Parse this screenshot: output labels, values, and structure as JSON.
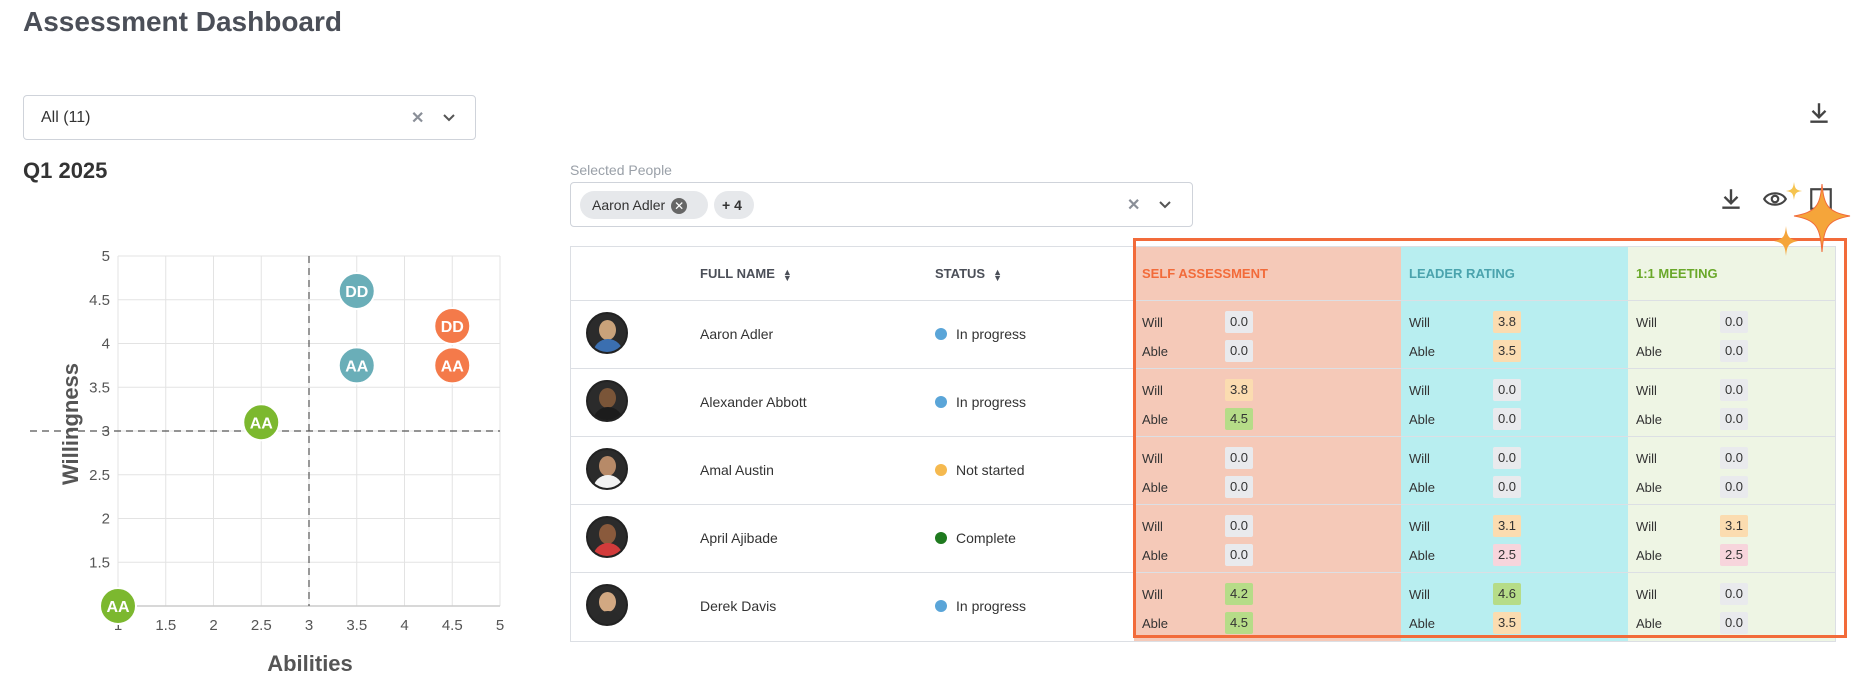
{
  "page": {
    "title": "Assessment Dashboard"
  },
  "filter": {
    "value": "All (11)"
  },
  "period": "Q1 2025",
  "chart_data": {
    "type": "scatter",
    "xlabel": "Abilities",
    "ylabel": "Willingness",
    "xlim": [
      1,
      5
    ],
    "ylim": [
      1,
      5
    ],
    "x_ticks": [
      "1",
      "1.5",
      "2",
      "2.5",
      "3",
      "3.5",
      "4",
      "4.5",
      "5"
    ],
    "y_ticks": [
      "1.5",
      "2",
      "2.5",
      "3",
      "3.5",
      "4",
      "4.5",
      "5"
    ],
    "grid": true,
    "reference_lines": {
      "x": 3,
      "y": 3
    },
    "points": [
      {
        "label": "DD",
        "x": 3.5,
        "y": 4.6,
        "color": "#6aaeb8"
      },
      {
        "label": "DD",
        "x": 4.5,
        "y": 4.2,
        "color": "#f47a4a"
      },
      {
        "label": "AA",
        "x": 3.5,
        "y": 3.75,
        "color": "#6aaeb8"
      },
      {
        "label": "AA",
        "x": 4.5,
        "y": 3.75,
        "color": "#f47a4a"
      },
      {
        "label": "AA",
        "x": 2.5,
        "y": 3.1,
        "color": "#7cb82f"
      },
      {
        "label": "AA",
        "x": 1,
        "y": 1,
        "color": "#7cb82f"
      }
    ]
  },
  "selected_people": {
    "label": "Selected People",
    "chip": "Aaron Adler",
    "more": "+ 4"
  },
  "table": {
    "headers": {
      "full_name": "FULL NAME",
      "status": "STATUS",
      "self": "SELF ASSESSMENT",
      "leader": "LEADER RATING",
      "meeting": "1:1 MEETING"
    },
    "will_label": "Will",
    "able_label": "Able",
    "rows": [
      {
        "name": "Aaron Adler",
        "status": "In progress",
        "status_color": "#5aa5d8",
        "self": {
          "will": "0.0",
          "able": "0.0"
        },
        "leader": {
          "will": "3.8",
          "able": "3.5"
        },
        "meeting": {
          "will": "0.0",
          "able": "0.0"
        }
      },
      {
        "name": "Alexander Abbott",
        "status": "In progress",
        "status_color": "#5aa5d8",
        "self": {
          "will": "3.8",
          "able": "4.5"
        },
        "leader": {
          "will": "0.0",
          "able": "0.0"
        },
        "meeting": {
          "will": "0.0",
          "able": "0.0"
        }
      },
      {
        "name": "Amal Austin",
        "status": "Not started",
        "status_color": "#f5b94f",
        "self": {
          "will": "0.0",
          "able": "0.0"
        },
        "leader": {
          "will": "0.0",
          "able": "0.0"
        },
        "meeting": {
          "will": "0.0",
          "able": "0.0"
        }
      },
      {
        "name": "April Ajibade",
        "status": "Complete",
        "status_color": "#1f7a1f",
        "self": {
          "will": "0.0",
          "able": "0.0"
        },
        "leader": {
          "will": "3.1",
          "able": "2.5"
        },
        "meeting": {
          "will": "3.1",
          "able": "2.5"
        }
      },
      {
        "name": "Derek Davis",
        "status": "In progress",
        "status_color": "#5aa5d8",
        "self": {
          "will": "4.2",
          "able": "4.5"
        },
        "leader": {
          "will": "4.6",
          "able": "3.5"
        },
        "meeting": {
          "will": "0.0",
          "able": "0.0"
        }
      }
    ]
  },
  "colors": {
    "self_bg": "#f5c9b8",
    "self_text": "#f26b3a",
    "leader_bg": "#b8eef0",
    "leader_text": "#4aa3ad",
    "meeting_bg": "#eef5e4",
    "meeting_text": "#6aa82a",
    "highlight": "#f26b3a",
    "sparkle": "#f5a53a"
  }
}
